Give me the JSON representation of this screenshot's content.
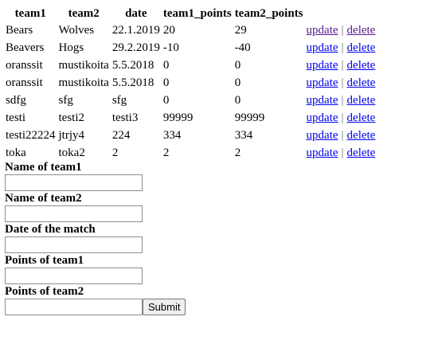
{
  "table": {
    "headers": [
      "team1",
      "team2",
      "date",
      "team1_points",
      "team2_points"
    ],
    "rows": [
      {
        "team1": "Bears",
        "team2": "Wolves",
        "date": "22.1.2019",
        "team1_points": "20",
        "team2_points": "29"
      },
      {
        "team1": "Beavers",
        "team2": "Hogs",
        "date": "29.2.2019",
        "team1_points": "-10",
        "team2_points": "-40"
      },
      {
        "team1": "oranssit",
        "team2": "mustikoita",
        "date": "5.5.2018",
        "team1_points": "0",
        "team2_points": "0"
      },
      {
        "team1": "oranssit",
        "team2": "mustikoita",
        "date": "5.5.2018",
        "team1_points": "0",
        "team2_points": "0"
      },
      {
        "team1": "sdfg",
        "team2": "sfg",
        "date": "sfg",
        "team1_points": "0",
        "team2_points": "0"
      },
      {
        "team1": "testi",
        "team2": "testi2",
        "date": "testi3",
        "team1_points": "99999",
        "team2_points": "99999"
      },
      {
        "team1": "testi22224",
        "team2": "jtrjy4",
        "date": "224",
        "team1_points": "334",
        "team2_points": "334"
      },
      {
        "team1": "toka",
        "team2": "toka2",
        "date": "2",
        "team1_points": "2",
        "team2_points": "2"
      }
    ],
    "update_label": "update",
    "separator": "|",
    "delete_label": "delete"
  },
  "form": {
    "team1_label": "Name of team1",
    "team2_label": "Name of team2",
    "date_label": "Date of the match",
    "team1_points_label": "Points of team1",
    "team2_points_label": "Points of team2",
    "team1_value": "",
    "team2_value": "",
    "date_value": "",
    "team1_points_value": "",
    "team2_points_value": "",
    "submit_label": "Submit"
  },
  "colors": {
    "link": "#0000ee",
    "visited_link": "#551a8b"
  }
}
